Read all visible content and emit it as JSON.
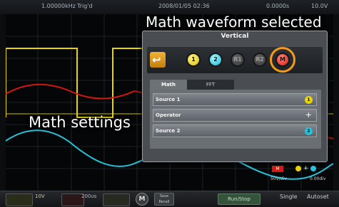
{
  "topbar": {
    "frequency": "1.00000kHz",
    "trigger_status": "Trig'd",
    "datetime": "2008/01/05  02:36",
    "time_offset": "0.0000s",
    "trigger_level": "10.0V"
  },
  "callouts": {
    "top": "Math waveform selected",
    "left": "Math settings"
  },
  "vertical_menu": {
    "title": "Vertical",
    "back_icon": "return-arrow-icon",
    "channels": [
      {
        "label": "1",
        "color": "#e8d400"
      },
      {
        "label": "2",
        "color": "#27c2da"
      },
      {
        "label": "R1",
        "color": "#555555"
      },
      {
        "label": "R2",
        "color": "#555555"
      },
      {
        "label": "M",
        "color": "#d4180c",
        "selected": true
      }
    ],
    "tabs": [
      {
        "label": "Math",
        "active": true
      },
      {
        "label": "FFT",
        "active": false
      }
    ],
    "rows": [
      {
        "label": "Source 1",
        "value": "1"
      },
      {
        "label": "Operator",
        "value": "+"
      },
      {
        "label": "Source 2",
        "value": "2"
      }
    ]
  },
  "math_readout": {
    "badge": "M",
    "scale": "50V/div",
    "formula_op": "+",
    "offset": "0.00div"
  },
  "bottombar": {
    "ch1_scale": "10V",
    "timebase": "200us",
    "math_button": "M",
    "save_label": "Save\nRecall",
    "run_stop": "Run/Stop",
    "single": "Single",
    "autoset": "Autoset"
  },
  "colors": {
    "ch1": "#e8d400",
    "ch2": "#27c2da",
    "math": "#d4180c",
    "highlight": "#f49a16"
  }
}
